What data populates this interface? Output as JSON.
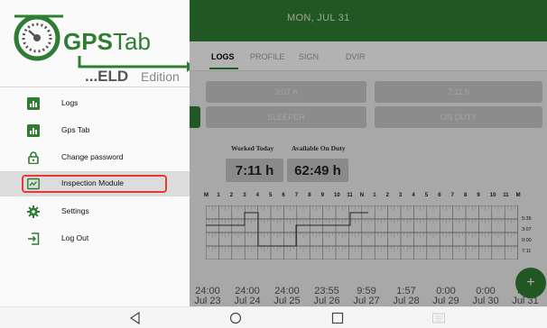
{
  "header": {
    "date": "MON, JUL 31"
  },
  "tabs": [
    "LOGS",
    "PROFILE",
    "SIGN",
    "DVIR"
  ],
  "status_buttons": [
    {
      "label": "3:07 h"
    },
    {
      "label": "7:11 h"
    },
    {
      "label": "SLEEPER"
    },
    {
      "label": "ON DUTY"
    }
  ],
  "summary": {
    "worked_label": "Worked Today",
    "worked_value": "7:11 h",
    "available_label": "Available On Duty",
    "available_value": "62:49 h"
  },
  "grid": {
    "hours": [
      "M",
      "1",
      "2",
      "3",
      "4",
      "5",
      "6",
      "7",
      "8",
      "9",
      "10",
      "11",
      "N",
      "1",
      "2",
      "3",
      "4",
      "5",
      "6",
      "7",
      "8",
      "9",
      "10",
      "11",
      "M"
    ],
    "totals": [
      "5:35",
      "3:07",
      "0:00",
      "7:11"
    ]
  },
  "day_totals": [
    {
      "time": "24:00",
      "date": "Jul 23"
    },
    {
      "time": "24:00",
      "date": "Jul 24"
    },
    {
      "time": "24:00",
      "date": "Jul 25"
    },
    {
      "time": "23:55",
      "date": "Jul 26"
    },
    {
      "time": "9:59",
      "date": "Jul 27"
    },
    {
      "time": "1:57",
      "date": "Jul 28"
    },
    {
      "time": "0:00",
      "date": "Jul 29"
    },
    {
      "time": "0:00",
      "date": "Jul 30"
    },
    {
      "time": "7:11",
      "date": "Jul 31"
    }
  ],
  "fab": {
    "label": "+"
  },
  "logo": {
    "brand_bold": "GPS",
    "brand_light": "Tab",
    "edition_bold": "...ELD",
    "edition_light": "Edition"
  },
  "menu": [
    {
      "label": "Logs",
      "icon": "bar-chart-icon"
    },
    {
      "label": "Gps Tab",
      "icon": "bar-chart-icon"
    },
    {
      "label": "Change password",
      "icon": "lock-icon"
    },
    {
      "label": "Inspection Module",
      "icon": "inspection-icon"
    },
    {
      "label": "Settings",
      "icon": "gear-icon"
    },
    {
      "label": "Log Out",
      "icon": "logout-icon"
    }
  ],
  "selected_menu_index": 3,
  "colors": {
    "primary": "#2e7d32",
    "highlight_border": "#e53935",
    "selected_bg": "#dcdcdc"
  },
  "system_nav": {
    "icons": [
      "back-icon",
      "home-icon",
      "recents-icon",
      "keyboard-icon"
    ]
  }
}
